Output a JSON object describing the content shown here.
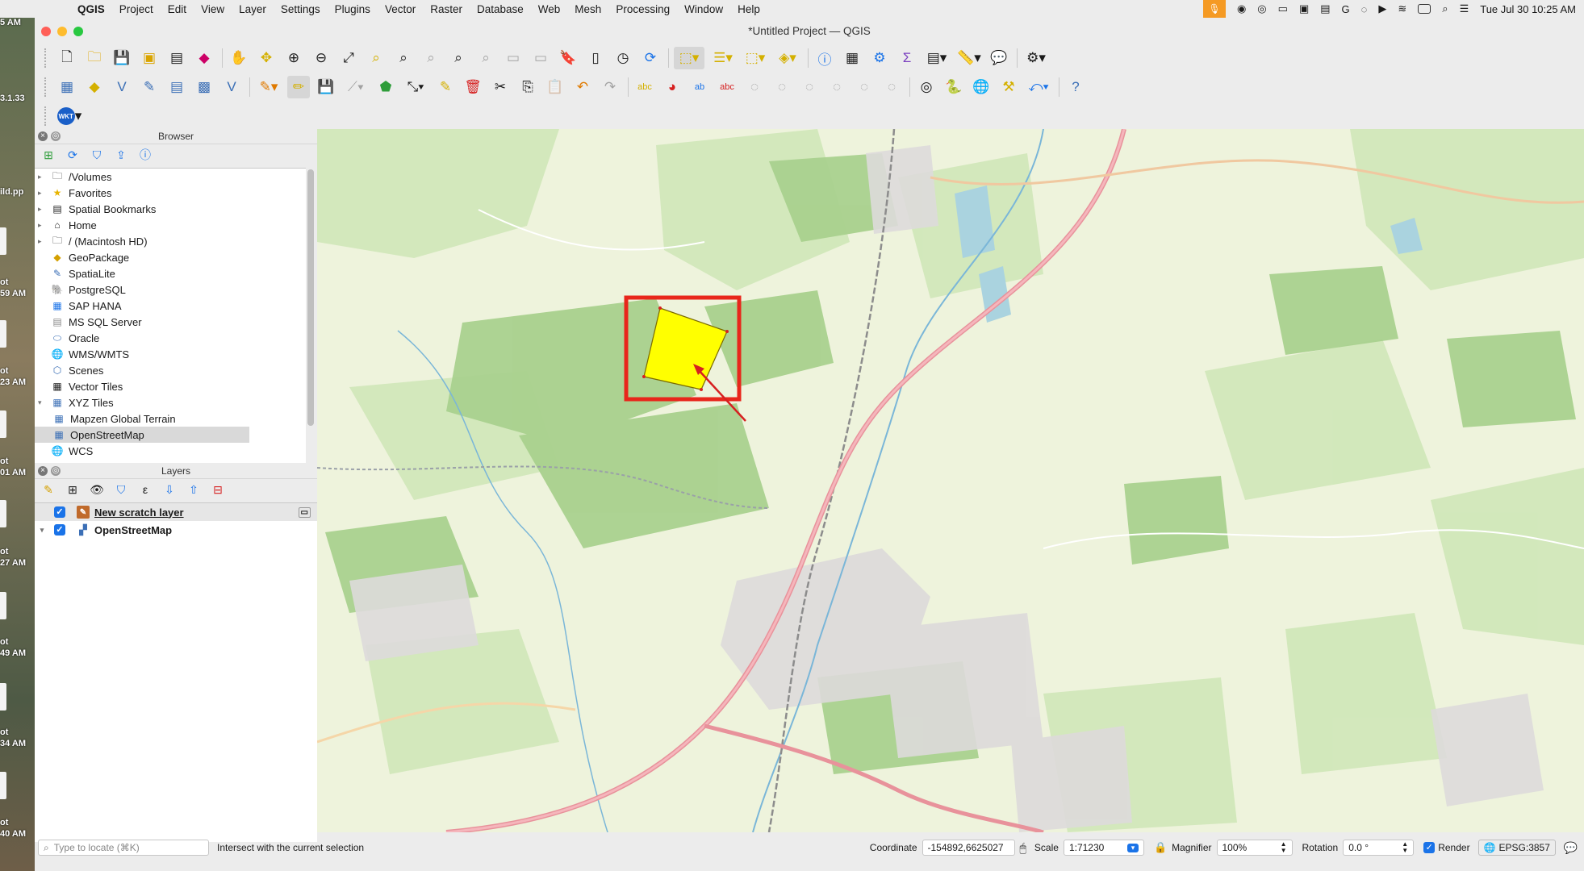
{
  "menubar": {
    "app_name": "QGIS",
    "items": [
      "Project",
      "Edit",
      "View",
      "Layer",
      "Settings",
      "Plugins",
      "Vector",
      "Raster",
      "Database",
      "Web",
      "Mesh",
      "Processing",
      "Window",
      "Help"
    ],
    "clock": "Tue Jul 30  10:25 AM"
  },
  "desktop": {
    "labels": [
      "5 AM",
      "3.1.33",
      "ild.pp",
      "ot",
      "59 AM",
      "ot",
      "23 AM",
      "ot",
      "01 AM",
      "ot",
      "27 AM",
      "ot",
      "49 AM",
      "ot",
      "34 AM",
      "ot",
      "40 AM"
    ]
  },
  "window": {
    "title": "*Untitled Project — QGIS"
  },
  "browser": {
    "title": "Browser",
    "items": [
      {
        "label": "/Volumes",
        "icon": "folder-icon"
      },
      {
        "label": "Favorites",
        "icon": "star-icon"
      },
      {
        "label": "Spatial Bookmarks",
        "icon": "bookmark-icon"
      },
      {
        "label": "Home",
        "icon": "home-folder-icon"
      },
      {
        "label": "/ (Macintosh HD)",
        "icon": "folder-icon"
      },
      {
        "label": "GeoPackage",
        "icon": "geopackage-icon"
      },
      {
        "label": "SpatiaLite",
        "icon": "spatialite-icon"
      },
      {
        "label": "PostgreSQL",
        "icon": "postgresql-icon"
      },
      {
        "label": "SAP HANA",
        "icon": "saphana-icon"
      },
      {
        "label": "MS SQL Server",
        "icon": "mssql-icon"
      },
      {
        "label": "Oracle",
        "icon": "oracle-icon"
      },
      {
        "label": "WMS/WMTS",
        "icon": "globe-icon"
      },
      {
        "label": "Scenes",
        "icon": "scenes-icon"
      },
      {
        "label": "Vector Tiles",
        "icon": "grid-icon"
      },
      {
        "label": "XYZ Tiles",
        "icon": "grid-icon"
      },
      {
        "label": "Mapzen Global Terrain",
        "icon": "grid-icon"
      },
      {
        "label": "OpenStreetMap",
        "icon": "grid-icon"
      },
      {
        "label": "WCS",
        "icon": "globe-icon"
      }
    ]
  },
  "layers": {
    "title": "Layers",
    "items": [
      {
        "label": "New scratch layer",
        "checked": true
      },
      {
        "label": "OpenStreetMap",
        "checked": true
      }
    ]
  },
  "status": {
    "locate_placeholder": "Type to locate (⌘K)",
    "message": "Intersect with the current selection",
    "coordinate_label": "Coordinate",
    "coordinate_value": "-154892,6625027",
    "scale_label": "Scale",
    "scale_value": "1:71230",
    "magnifier_label": "Magnifier",
    "magnifier_value": "100%",
    "rotation_label": "Rotation",
    "rotation_value": "0.0 °",
    "render_label": "Render",
    "crs": "EPSG:3857"
  },
  "colors": {
    "accent": "#1a73e8",
    "polygon_fill": "#ffff00",
    "highlight": "#e8261b",
    "map_bg": "#eaf1d9"
  }
}
